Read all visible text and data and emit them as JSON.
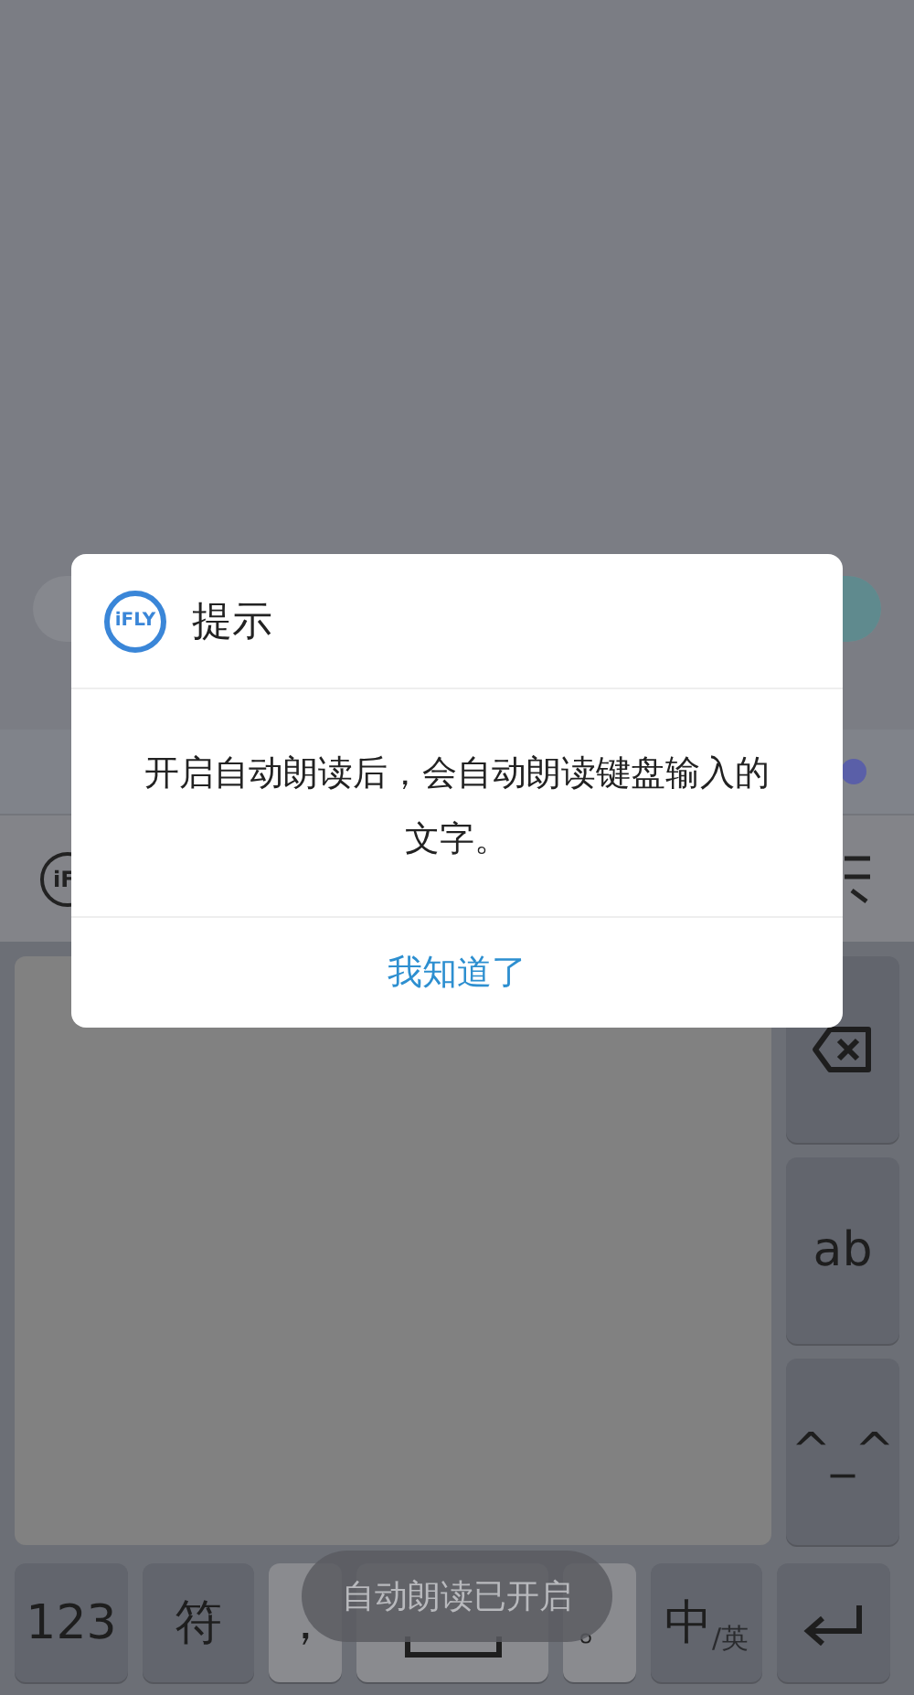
{
  "candidate_bar": {
    "logo_text": "iF"
  },
  "dialog": {
    "logo_text": "iFLY",
    "title": "提示",
    "message": "开启自动朗读后，会自动朗读键盘输入的文字。",
    "button": "我知道了"
  },
  "side_keys": [
    {
      "kind": "delete"
    },
    {
      "kind": "text",
      "label": "ab"
    },
    {
      "kind": "text",
      "label": "^_^"
    }
  ],
  "bottom_keys": [
    {
      "kind": "text",
      "label": "123"
    },
    {
      "kind": "text",
      "label": "符"
    },
    {
      "kind": "punct",
      "label": "，"
    },
    {
      "kind": "space"
    },
    {
      "kind": "punct",
      "label": "。"
    },
    {
      "kind": "lang",
      "label": "中",
      "sub": "/英"
    },
    {
      "kind": "enter"
    }
  ],
  "toast": "自动朗读已开启"
}
